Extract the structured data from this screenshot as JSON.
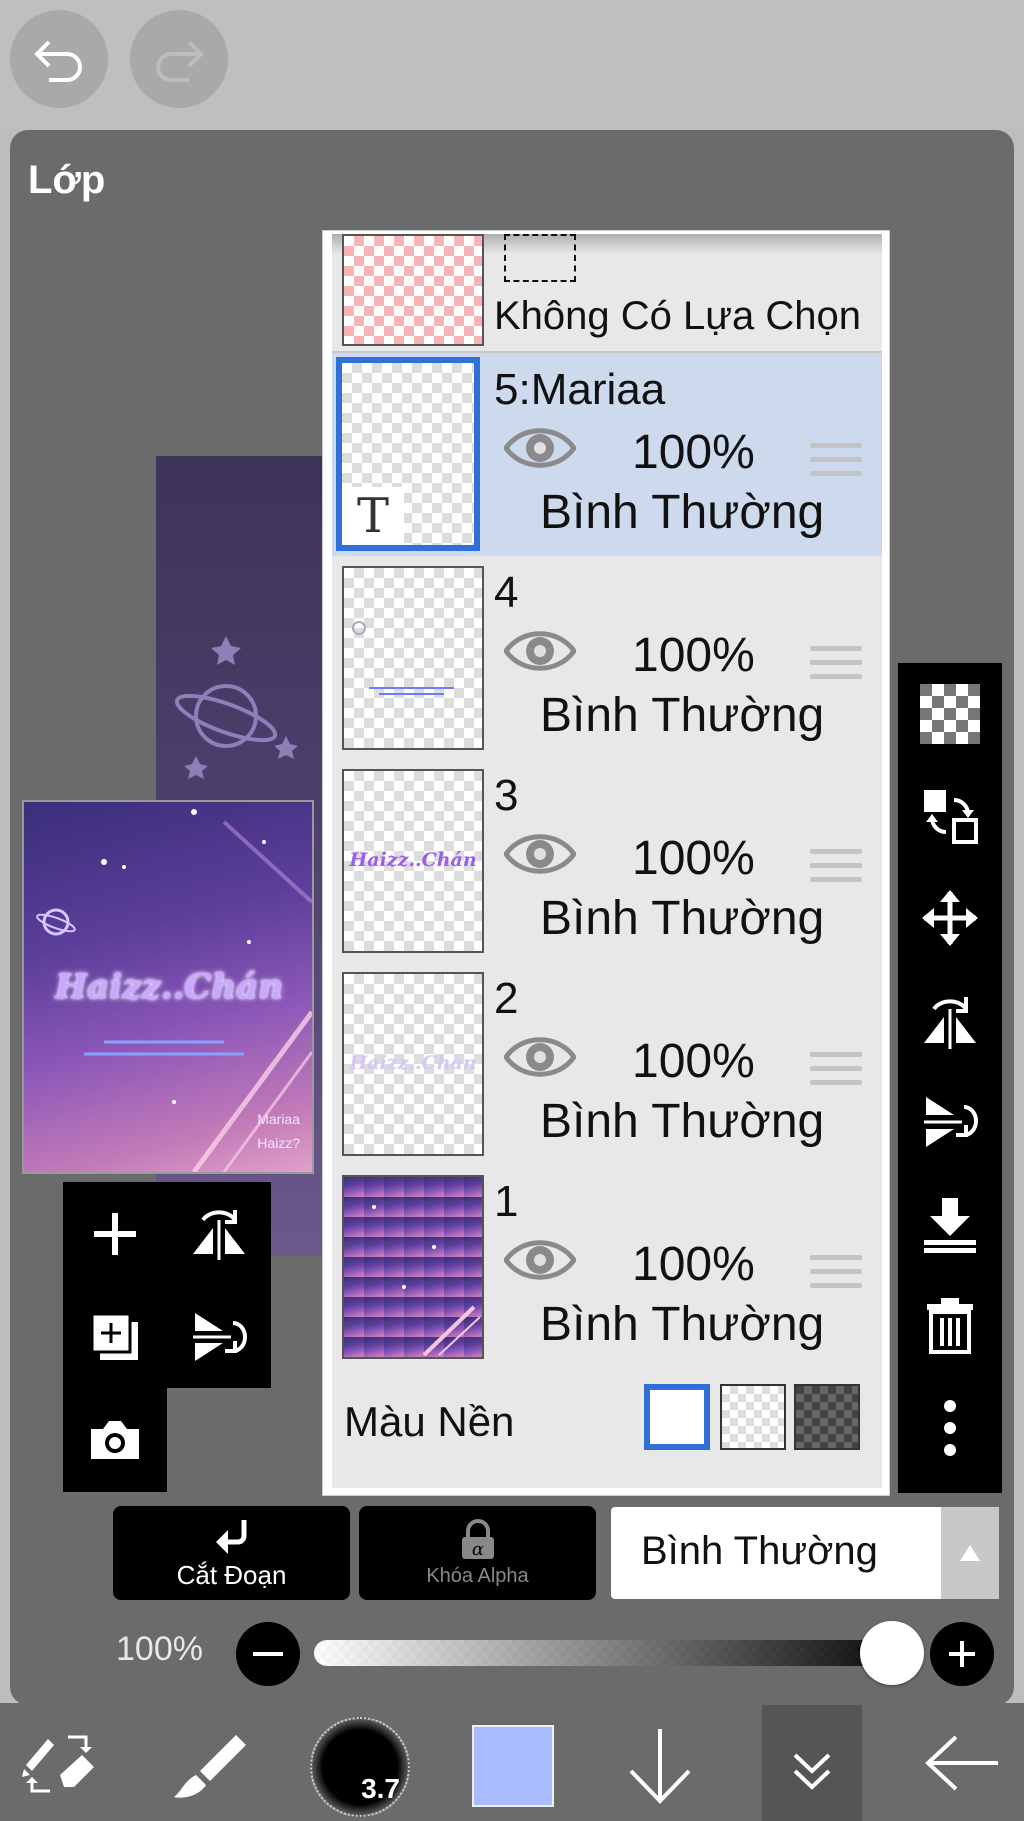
{
  "panel": {
    "title": "Lớp"
  },
  "preview": {
    "art_title": "Haizz..Chán",
    "credit_line1": "Mariaa",
    "credit_line2": "Haizz?"
  },
  "selection_row": {
    "label": "Không Có Lựa Chọn"
  },
  "layers": [
    {
      "name": "5:Mariaa",
      "opacity": "100%",
      "blend": "Bình Thường",
      "selected": true,
      "thumb_glyph": "T"
    },
    {
      "name": "4",
      "opacity": "100%",
      "blend": "Bình Thường",
      "selected": false
    },
    {
      "name": "3",
      "opacity": "100%",
      "blend": "Bình Thường",
      "selected": false,
      "thumb_text": "Haizz..Chán"
    },
    {
      "name": "2",
      "opacity": "100%",
      "blend": "Bình Thường",
      "selected": false,
      "thumb_text": "Haizz..Chán"
    },
    {
      "name": "1",
      "opacity": "100%",
      "blend": "Bình Thường",
      "selected": false
    }
  ],
  "background_color": {
    "label": "Màu Nền"
  },
  "bottom_controls": {
    "clip_label": "Cắt Đoạn",
    "alpha_lock_label": "Khóa Alpha",
    "blend_mode": "Bình Thường",
    "opacity_label": "100%",
    "opacity_value": 1.0
  },
  "toolbar": {
    "brush_size": "3.7",
    "color": "#a9bcff"
  },
  "colors": {
    "accent": "#2f6fd6",
    "selected_row": "#cdd9ec",
    "panel": "#6b6b6b"
  }
}
